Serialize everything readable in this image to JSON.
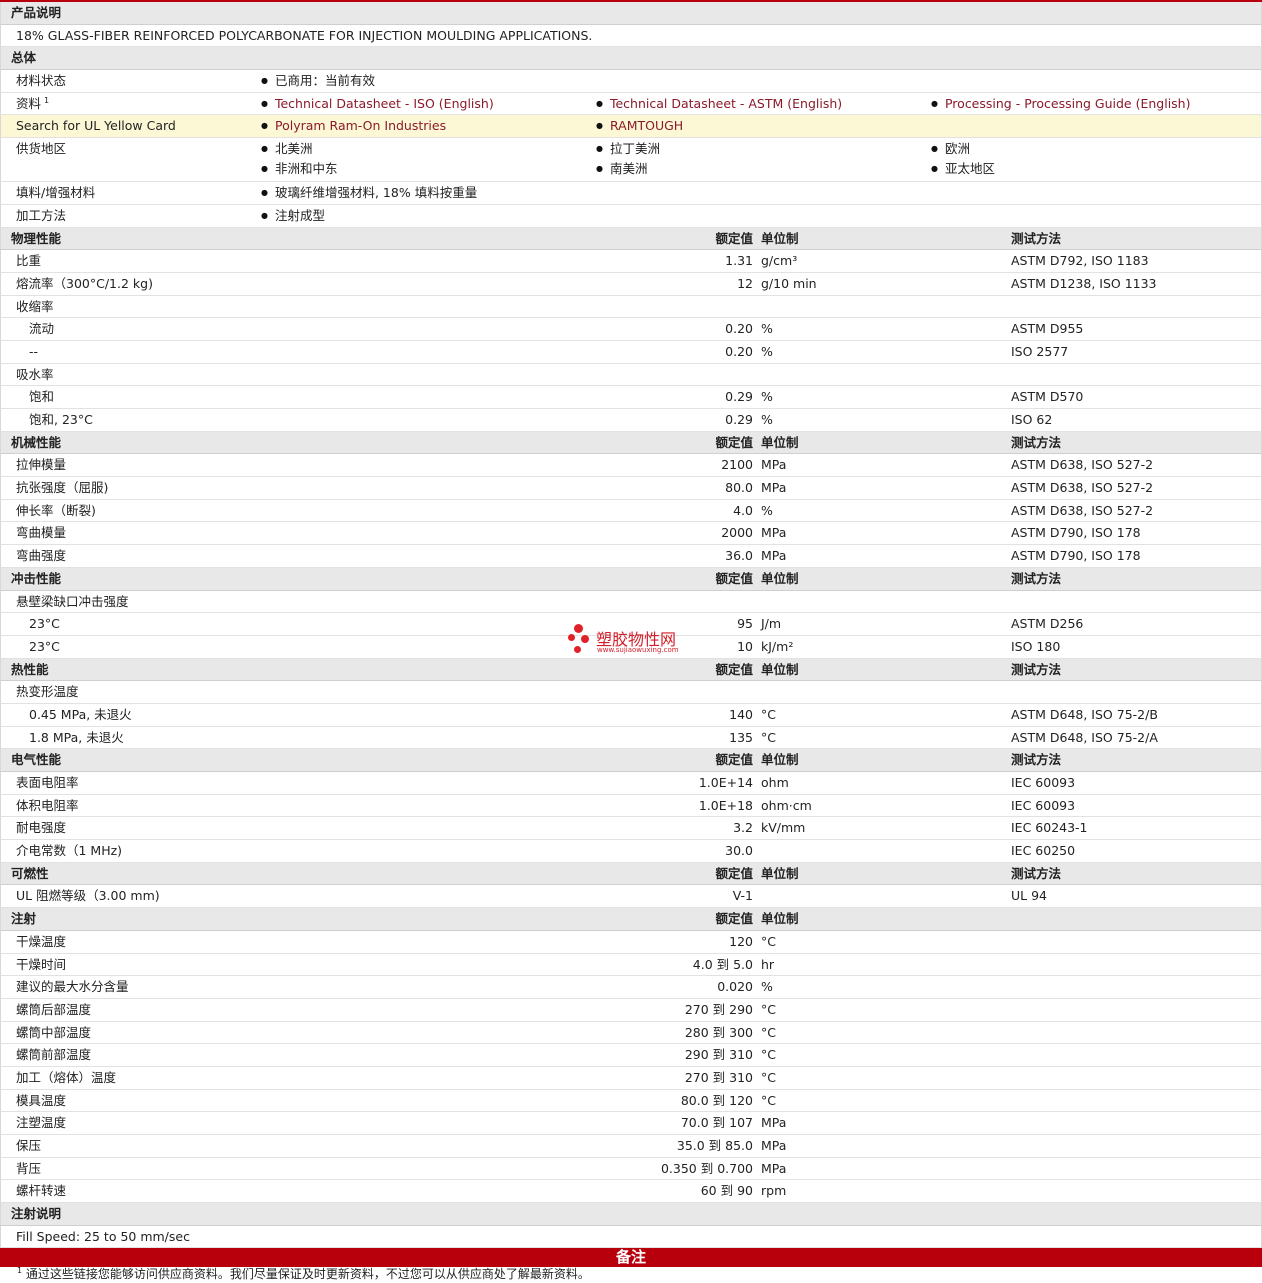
{
  "headers": {
    "value": "额定值",
    "unit": "单位制",
    "test": "测试方法"
  },
  "desc": {
    "title": "产品说明",
    "text": "18% GLASS-FIBER REINFORCED POLYCARBONATE FOR INJECTION MOULDING APPLICATIONS."
  },
  "general": {
    "title": "总体",
    "status_label": "材料状态",
    "status_value": "已商用：当前有效",
    "docs_label": "资料",
    "docs_sup": "1",
    "docs": [
      "Technical Datasheet - ISO (English)",
      "Technical Datasheet - ASTM (English)",
      "Processing - Processing Guide (English)"
    ],
    "ul_label": "Search for UL Yellow Card",
    "ul_links": [
      "Polyram Ram-On Industries",
      "RAMTOUGH"
    ],
    "region_label": "供货地区",
    "regions": [
      "北美洲",
      "拉丁美洲",
      "欧洲",
      "非洲和中东",
      "南美洲",
      "亚太地区"
    ],
    "filler_label": "填料/增强材料",
    "filler_value": "玻璃纤维增强材料, 18% 填料按重量",
    "process_label": "加工方法",
    "process_value": "注射成型"
  },
  "physical": {
    "title": "物理性能",
    "rows": [
      {
        "label": "比重",
        "value": "1.31",
        "unit": "g/cm³",
        "test": "ASTM D792, ISO 1183"
      },
      {
        "label": "熔流率（300°C/1.2 kg)",
        "value": "12",
        "unit": "g/10 min",
        "test": "ASTM D1238, ISO 1133"
      },
      {
        "label": "收缩率",
        "value": "",
        "unit": "",
        "test": ""
      },
      {
        "label": "流动",
        "value": "0.20",
        "unit": "%",
        "test": "ASTM D955",
        "sub": true
      },
      {
        "label": "--",
        "value": "0.20",
        "unit": "%",
        "test": "ISO 2577",
        "sub": true
      },
      {
        "label": "吸水率",
        "value": "",
        "unit": "",
        "test": ""
      },
      {
        "label": "饱和",
        "value": "0.29",
        "unit": "%",
        "test": "ASTM D570",
        "sub": true
      },
      {
        "label": "饱和, 23°C",
        "value": "0.29",
        "unit": "%",
        "test": "ISO 62",
        "sub": true
      }
    ]
  },
  "mechanical": {
    "title": "机械性能",
    "rows": [
      {
        "label": "拉伸模量",
        "value": "2100",
        "unit": "MPa",
        "test": "ASTM D638, ISO 527-2"
      },
      {
        "label": "抗张强度（屈服)",
        "value": "80.0",
        "unit": "MPa",
        "test": "ASTM D638, ISO 527-2"
      },
      {
        "label": "伸长率（断裂)",
        "value": "4.0",
        "unit": "%",
        "test": "ASTM D638, ISO 527-2"
      },
      {
        "label": "弯曲模量",
        "value": "2000",
        "unit": "MPa",
        "test": "ASTM D790, ISO 178"
      },
      {
        "label": "弯曲强度",
        "value": "36.0",
        "unit": "MPa",
        "test": "ASTM D790, ISO 178"
      }
    ]
  },
  "impact": {
    "title": "冲击性能",
    "rows": [
      {
        "label": "悬壁梁缺口冲击强度",
        "value": "",
        "unit": "",
        "test": ""
      },
      {
        "label": "23°C",
        "value": "95",
        "unit": "J/m",
        "test": "ASTM D256",
        "sub": true
      },
      {
        "label": "23°C",
        "value": "10",
        "unit": "kJ/m²",
        "test": "ISO 180",
        "sub": true
      }
    ]
  },
  "thermal": {
    "title": "热性能",
    "rows": [
      {
        "label": "热变形温度",
        "value": "",
        "unit": "",
        "test": ""
      },
      {
        "label": "0.45 MPa, 未退火",
        "value": "140",
        "unit": "°C",
        "test": "ASTM D648, ISO 75-2/B",
        "sub": true
      },
      {
        "label": "1.8 MPa, 未退火",
        "value": "135",
        "unit": "°C",
        "test": "ASTM D648, ISO 75-2/A",
        "sub": true
      }
    ]
  },
  "electrical": {
    "title": "电气性能",
    "rows": [
      {
        "label": "表面电阻率",
        "value": "1.0E+14",
        "unit": "ohm",
        "test": "IEC 60093"
      },
      {
        "label": "体积电阻率",
        "value": "1.0E+18",
        "unit": "ohm·cm",
        "test": "IEC 60093"
      },
      {
        "label": "耐电强度",
        "value": "3.2",
        "unit": "kV/mm",
        "test": "IEC 60243-1"
      },
      {
        "label": "介电常数（1 MHz)",
        "value": "30.0",
        "unit": "",
        "test": "IEC 60250"
      }
    ]
  },
  "flammability": {
    "title": "可燃性",
    "rows": [
      {
        "label": "UL 阻燃等级（3.00 mm)",
        "value": "V-1",
        "unit": "",
        "test": "UL 94"
      }
    ]
  },
  "injection": {
    "title": "注射",
    "rows": [
      {
        "label": "干燥温度",
        "value": "120",
        "unit": "°C"
      },
      {
        "label": "干燥时间",
        "value": "4.0 到  5.0",
        "unit": "hr"
      },
      {
        "label": "建议的最大水分含量",
        "value": "0.020",
        "unit": "%"
      },
      {
        "label": "螺筒后部温度",
        "value": "270 到  290",
        "unit": "°C"
      },
      {
        "label": "螺筒中部温度",
        "value": "280 到  300",
        "unit": "°C"
      },
      {
        "label": "螺筒前部温度",
        "value": "290 到  310",
        "unit": "°C"
      },
      {
        "label": "加工（熔体）温度",
        "value": "270 到  310",
        "unit": "°C"
      },
      {
        "label": "模具温度",
        "value": "80.0 到  120",
        "unit": "°C"
      },
      {
        "label": "注塑温度",
        "value": "70.0 到  107",
        "unit": "MPa"
      },
      {
        "label": "保压",
        "value": "35.0 到  85.0",
        "unit": "MPa"
      },
      {
        "label": "背压",
        "value": "0.350 到  0.700",
        "unit": "MPa"
      },
      {
        "label": "螺杆转速",
        "value": "60 到  90",
        "unit": "rpm"
      }
    ]
  },
  "injection_notes": {
    "title": "注射说明",
    "text": "Fill Speed: 25 to 50 mm/sec"
  },
  "notes": {
    "title": "备注",
    "sup": "1",
    "text": "通过这些链接您能够访问供应商资料。我们尽量保证及时更新资料，不过您可以从供应商处了解最新资料。"
  },
  "watermark": {
    "title": "塑胶物性网",
    "url": "www.sujiaowuxing.com"
  }
}
